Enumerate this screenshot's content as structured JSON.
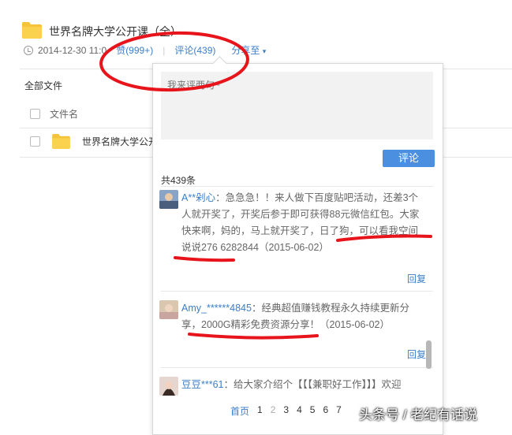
{
  "header": {
    "title": "世界名牌大学公开课（全）",
    "date": "2014-12-30 11:0",
    "like_label": "赞(999+)",
    "comment_label": "评论(439)",
    "share_label": "分享至"
  },
  "file_list": {
    "all_files_label": "全部文件",
    "column_name": "文件名",
    "rows": [
      {
        "name": "世界名牌大学公开"
      }
    ]
  },
  "comment_panel": {
    "input_placeholder": "我来评两句~",
    "submit_label": "评论",
    "total_label": "共439条",
    "comments": [
      {
        "user": "A**剁心",
        "text": "：急急急！！来人做下百度贴吧活动，还差3个人就开奖了，开奖后参于即可获得88元微信红包。大家快来啊，妈的，马上就开奖了，日了狗，可以看我空间说说276 6282844（2015-06-02）",
        "reply_label": "回复"
      },
      {
        "user": "Amy_******4845",
        "text": "：经典超值赚钱教程永久持续更新分享，2000G精彩免费资源分享！（2015-06-02）",
        "reply_label": "回复"
      },
      {
        "user": "豆豆***61",
        "text": "：给大家介绍个【【【兼职好工作】】】欢迎"
      }
    ],
    "pagination": {
      "first": "首页",
      "pages": [
        "1",
        "2",
        "3",
        "4",
        "5",
        "6",
        "7"
      ],
      "current": "2"
    }
  },
  "watermark": "头条号 / 老纪有话说",
  "colors": {
    "accent": "#3b7ec8",
    "button": "#4a8fe0",
    "annotation_red": "#e8141b",
    "folder": "#f5c43a"
  }
}
